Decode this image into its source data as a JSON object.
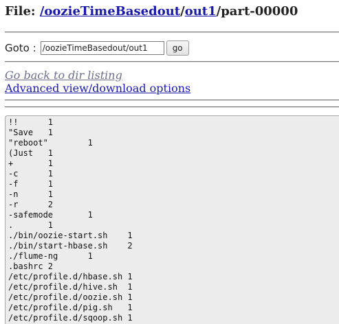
{
  "header": {
    "prefix": "File: ",
    "path_link_1": "/oozieTimeBasedout",
    "separator": "/",
    "path_link_2": "out1",
    "file_name": "/part-00000"
  },
  "goto": {
    "label": "Goto :",
    "value": "/oozieTimeBasedout/out1",
    "button_label": "go"
  },
  "links": {
    "back": "Go back to dir listing",
    "advanced": "Advanced view/download options"
  },
  "file_contents": [
    "!!\t1",
    "\"Save\t1",
    "\"reboot\"\t1",
    "(Just\t1",
    "+\t1",
    "-c\t1",
    "-f\t1",
    "-n\t1",
    "-r\t2",
    "-safemode\t1",
    ".\t1",
    "./bin/oozie-start.sh\t1",
    "./bin/start-hbase.sh\t2",
    "./flume-ng\t1",
    ".bashrc 2",
    "/etc/profile.d/hbase.sh 1",
    "/etc/profile.d/hive.sh  1",
    "/etc/profile.d/oozie.sh 1",
    "/etc/profile.d/pig.sh   1",
    "/etc/profile.d/sqoop.sh 1"
  ]
}
